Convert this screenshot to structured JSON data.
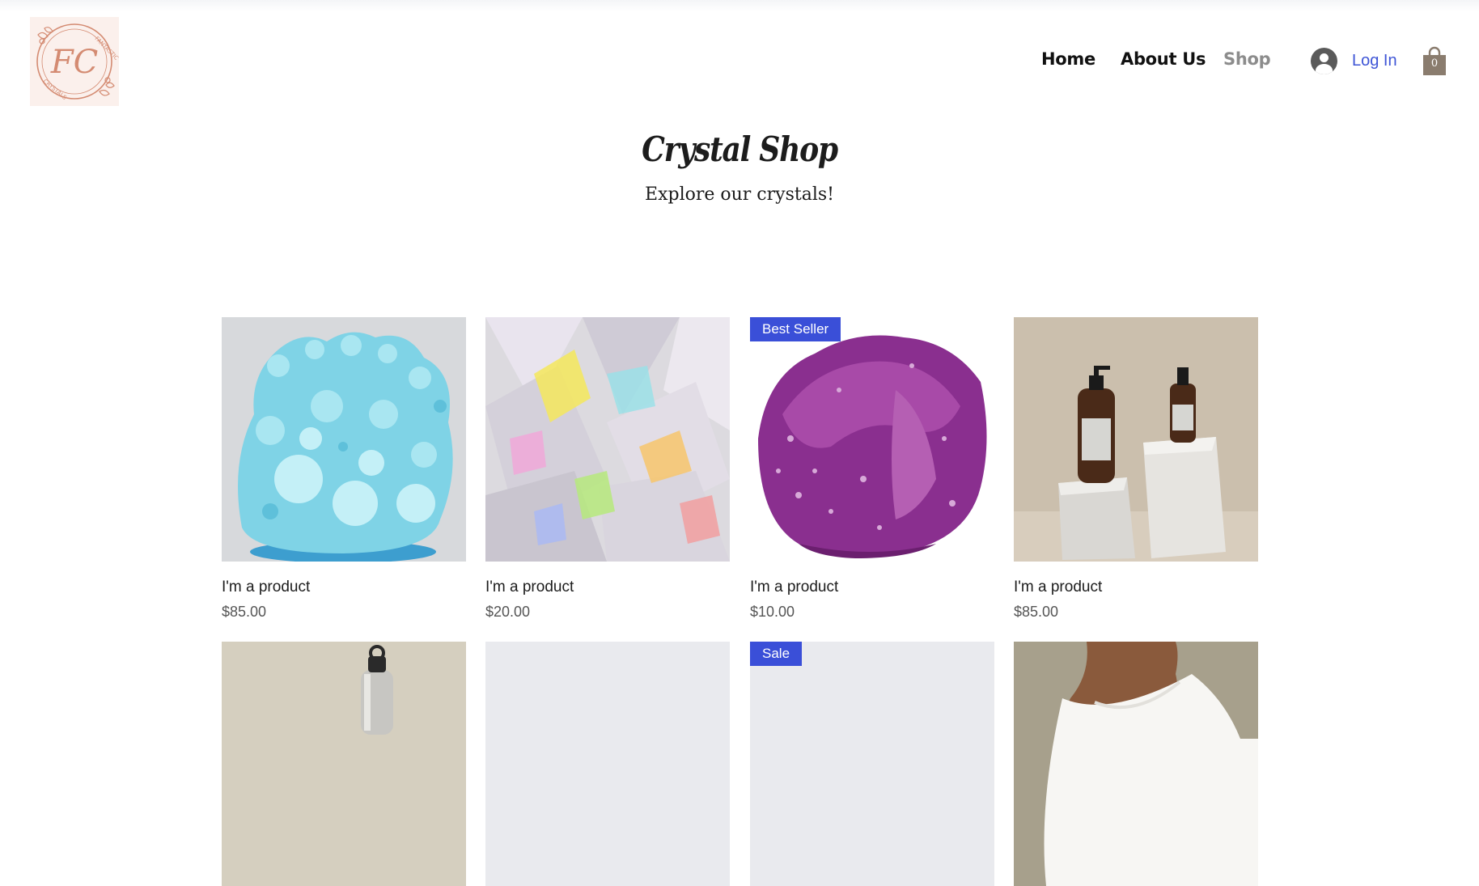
{
  "header": {
    "logo_monogram": "FC",
    "logo_text_top": "FANTASTIC",
    "logo_text_bottom": "CRYSTALS",
    "nav": {
      "home": "Home",
      "about": "About Us",
      "shop": "Shop"
    },
    "login_label": "Log In",
    "cart_count": "0"
  },
  "hero": {
    "title": "Crystal Shop",
    "subtitle": "Explore our crystals!"
  },
  "products": [
    {
      "name": "I'm a product",
      "price": "$85.00",
      "ribbon": "",
      "image": "blue-crystal-cluster"
    },
    {
      "name": "I'm a product",
      "price": "$20.00",
      "ribbon": "",
      "image": "aura-quartz-crystals"
    },
    {
      "name": "I'm a product",
      "price": "$10.00",
      "ribbon": "Best Seller",
      "image": "purple-stone"
    },
    {
      "name": "I'm a product",
      "price": "$85.00",
      "ribbon": "",
      "image": "amber-bottles-on-stone"
    },
    {
      "name": "",
      "price": "",
      "ribbon": "",
      "image": "water-bottle"
    },
    {
      "name": "",
      "price": "",
      "ribbon": "",
      "image": "placeholder"
    },
    {
      "name": "",
      "price": "",
      "ribbon": "Sale",
      "image": "placeholder"
    },
    {
      "name": "",
      "price": "",
      "ribbon": "",
      "image": "white-tshirt"
    }
  ],
  "colors": {
    "accent": "#3a4fd8",
    "login_link": "#3e55d6",
    "nav_active": "#8c8c8c",
    "cart_icon": "#8a7c6e",
    "logo_ink": "#d48b72"
  }
}
